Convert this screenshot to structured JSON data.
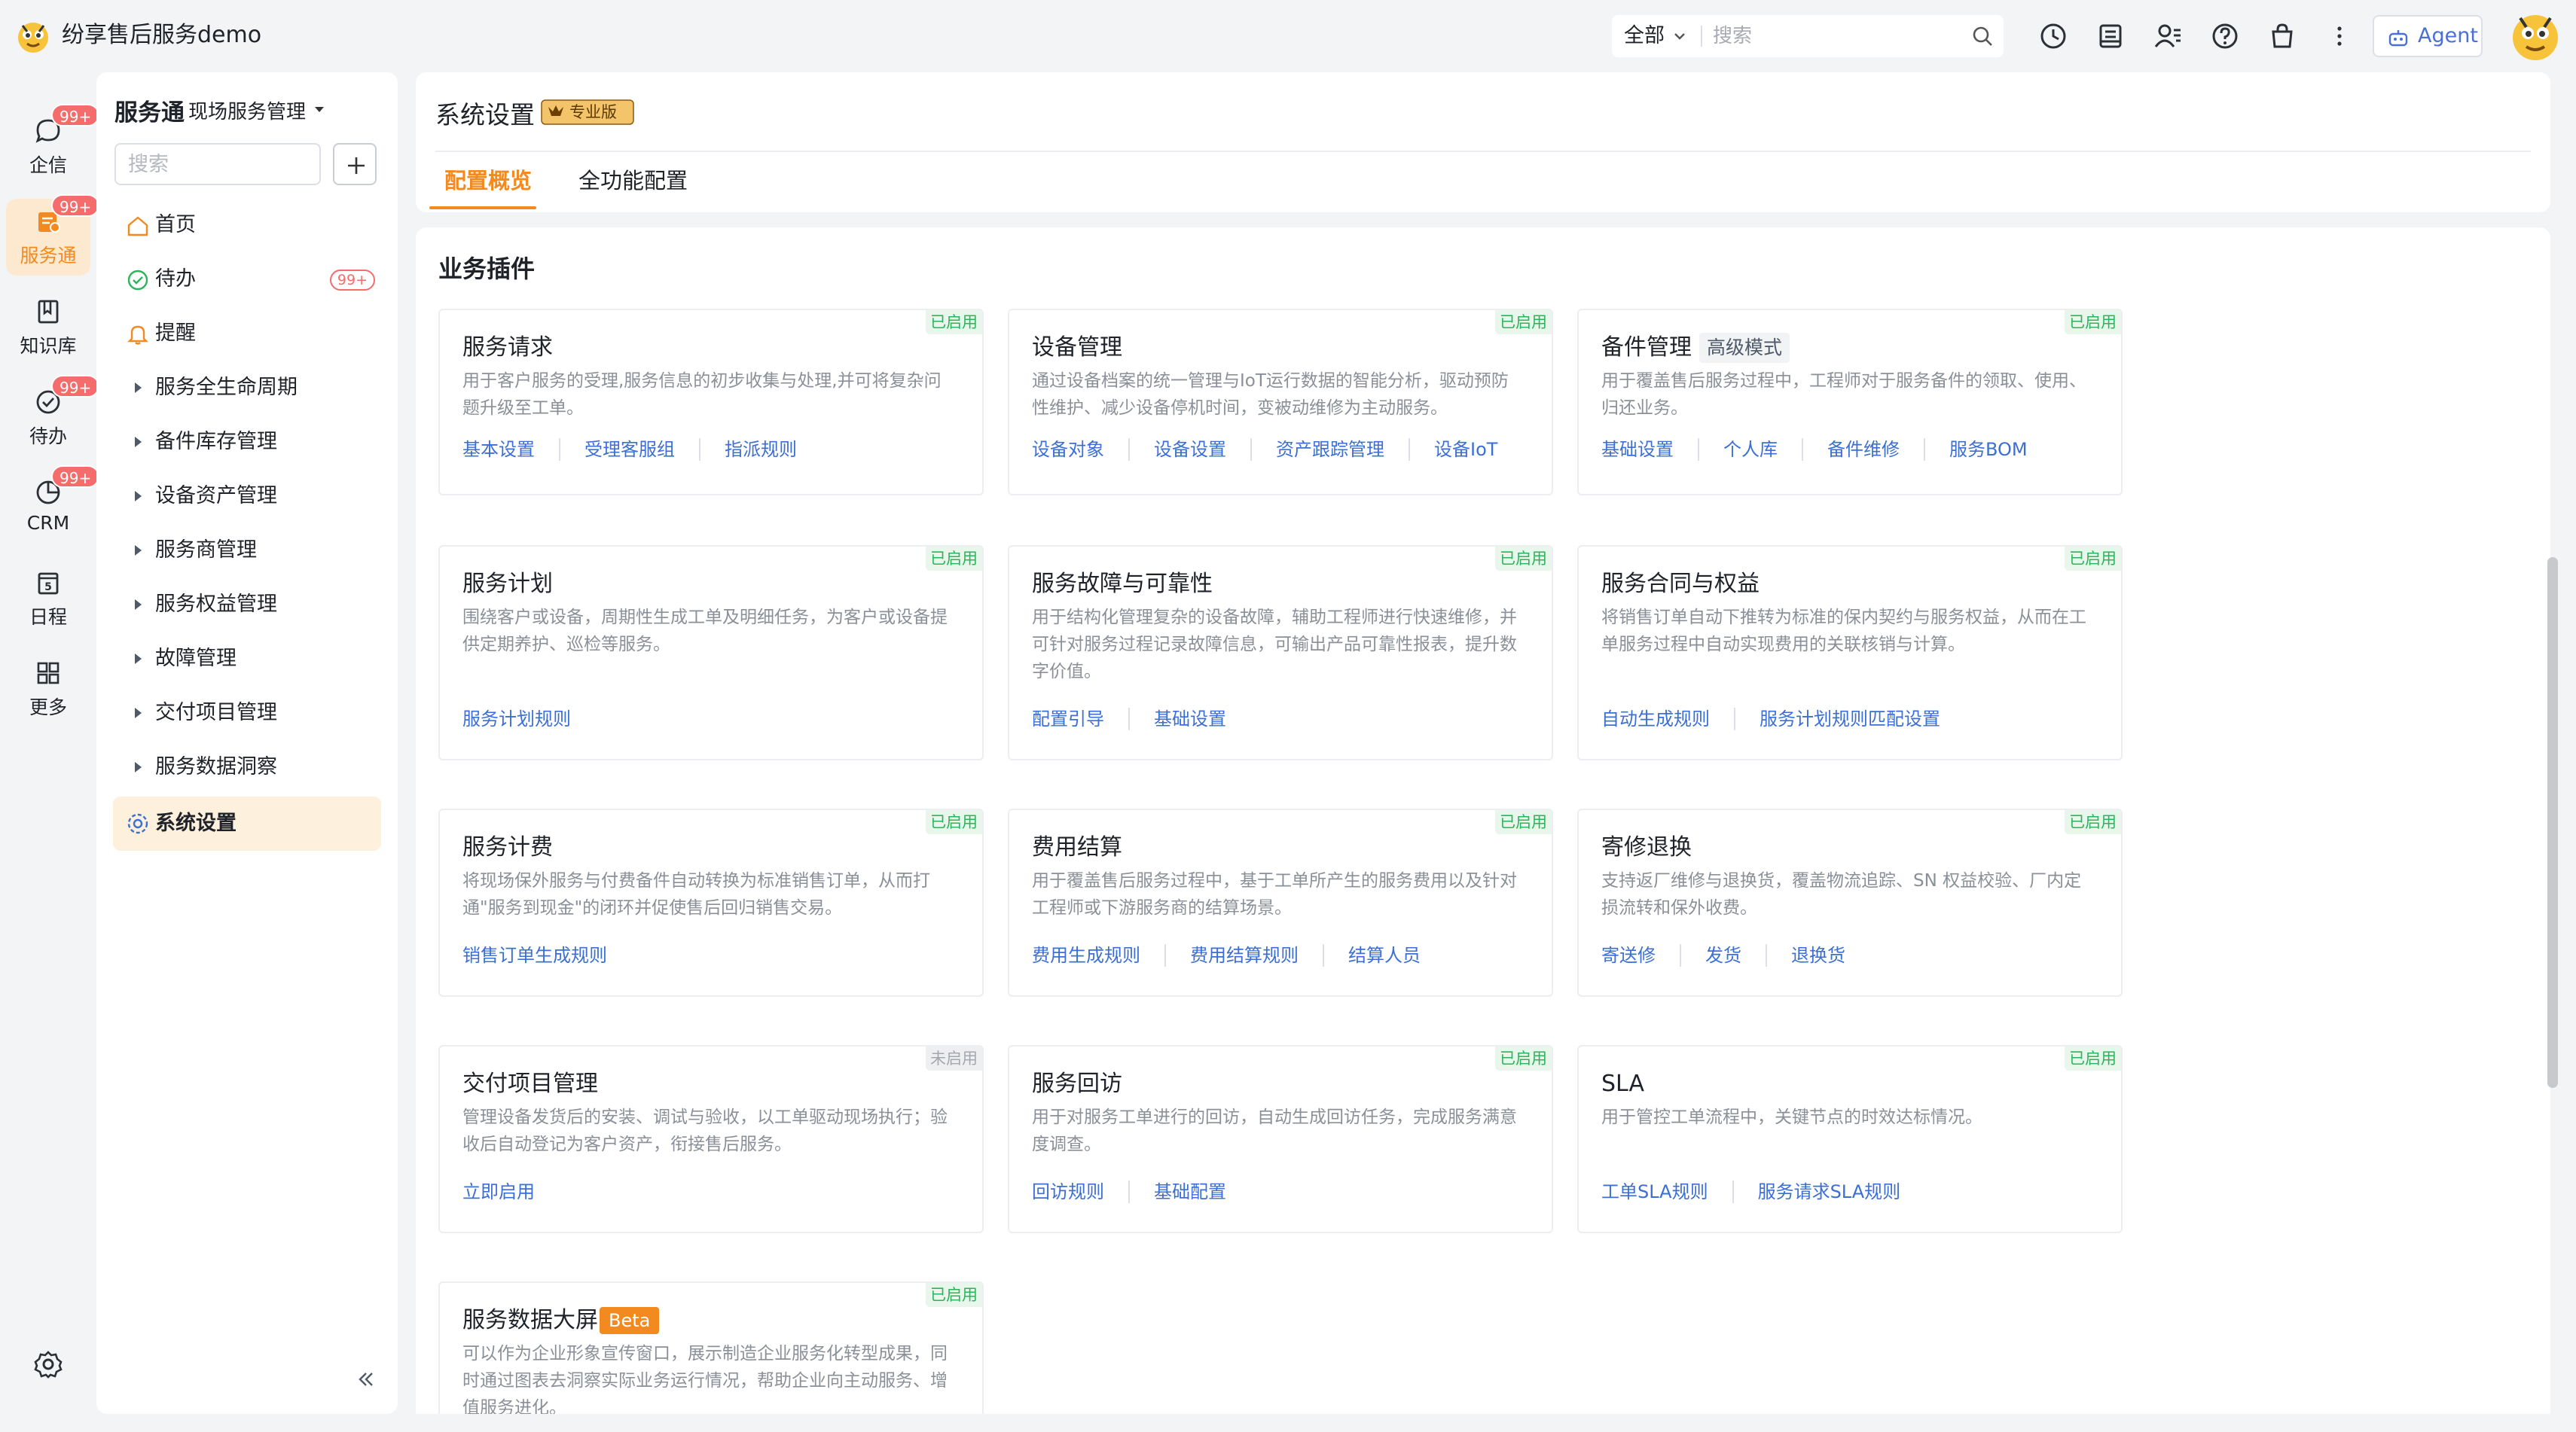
{
  "app": {
    "title": "纷享售后服务demo"
  },
  "topbar": {
    "search_scope": "全部",
    "search_placeholder": "搜索",
    "agent_label": "Agent",
    "icons": [
      "history-icon",
      "document-icon",
      "contacts-icon",
      "help-icon",
      "shop-icon",
      "more-icon"
    ]
  },
  "rail": {
    "items": [
      {
        "label": "企信",
        "badge": "99+",
        "icon": "chat-icon"
      },
      {
        "label": "服务通",
        "badge": "99+",
        "icon": "service-icon",
        "active": true
      },
      {
        "label": "知识库",
        "icon": "book-icon"
      },
      {
        "label": "待办",
        "badge": "99+",
        "icon": "check-icon"
      },
      {
        "label": "CRM",
        "badge": "99+",
        "icon": "pie-icon"
      },
      {
        "label": "日程",
        "icon": "calendar-icon"
      },
      {
        "label": "更多",
        "icon": "grid-icon"
      }
    ],
    "calendar_day": "5"
  },
  "sidebar": {
    "title": "服务通",
    "subtitle": "现场服务管理",
    "search_placeholder": "搜索",
    "items": [
      {
        "label": "首页",
        "icon": "home-icon"
      },
      {
        "label": "待办",
        "icon": "todo-icon",
        "badge": "99+"
      },
      {
        "label": "提醒",
        "icon": "bell-icon"
      },
      {
        "label": "服务全生命周期"
      },
      {
        "label": "备件库存管理"
      },
      {
        "label": "设备资产管理"
      },
      {
        "label": "服务商管理"
      },
      {
        "label": "服务权益管理"
      },
      {
        "label": "故障管理"
      },
      {
        "label": "交付项目管理"
      },
      {
        "label": "服务数据洞察"
      },
      {
        "label": "系统设置",
        "icon": "gear-icon",
        "active": true
      }
    ]
  },
  "header": {
    "title": "系统设置",
    "badge": "专业版",
    "tabs": [
      {
        "label": "配置概览",
        "active": true
      },
      {
        "label": "全功能配置"
      }
    ]
  },
  "main": {
    "section_title": "业务插件",
    "cards": [
      {
        "title": "服务请求",
        "status": "已启用",
        "desc": "用于客户服务的受理,服务信息的初步收集与处理,并可将复杂问题升级至工单。",
        "links": [
          "基本设置",
          "受理客服组",
          "指派规则"
        ]
      },
      {
        "title": "设备管理",
        "status": "已启用",
        "desc": "通过设备档案的统一管理与IoT运行数据的智能分析，驱动预防性维护、减少设备停机时间，变被动维修为主动服务。",
        "links": [
          "设备对象",
          "设备设置",
          "资产跟踪管理",
          "设备IoT"
        ]
      },
      {
        "title": "备件管理",
        "tag": "高级模式",
        "status": "已启用",
        "desc": "用于覆盖售后服务过程中，工程师对于服务备件的领取、使用、归还业务。",
        "links": [
          "基础设置",
          "个人库",
          "备件维修",
          "服务BOM"
        ]
      },
      {
        "title": "服务计划",
        "status": "已启用",
        "desc": "围绕客户或设备，周期性生成工单及明细任务，为客户或设备提供定期养护、巡检等服务。",
        "links": [
          "服务计划规则"
        ]
      },
      {
        "title": "服务故障与可靠性",
        "status": "已启用",
        "desc": "用于结构化管理复杂的设备故障，辅助工程师进行快速维修，并可针对服务过程记录故障信息，可输出产品可靠性报表，提升数字价值。",
        "links": [
          "配置引导",
          "基础设置"
        ]
      },
      {
        "title": "服务合同与权益",
        "status": "已启用",
        "desc": "将销售订单自动下推转为标准的保内契约与服务权益，从而在工单服务过程中自动实现费用的关联核销与计算。",
        "links": [
          "自动生成规则",
          "服务计划规则匹配设置"
        ]
      },
      {
        "title": "服务计费",
        "status": "已启用",
        "desc": "将现场保外服务与付费备件自动转换为标准销售订单，从而打通\"服务到现金\"的闭环并促使售后回归销售交易。",
        "links": [
          "销售订单生成规则"
        ]
      },
      {
        "title": "费用结算",
        "status": "已启用",
        "desc": "用于覆盖售后服务过程中，基于工单所产生的服务费用以及针对工程师或下游服务商的结算场景。",
        "links": [
          "费用生成规则",
          "费用结算规则",
          "结算人员"
        ]
      },
      {
        "title": "寄修退换",
        "status": "已启用",
        "desc": "支持返厂维修与退换货，覆盖物流追踪、SN 权益校验、厂内定损流转和保外收费。",
        "links": [
          "寄送修",
          "发货",
          "退换货"
        ]
      },
      {
        "title": "交付项目管理",
        "status": "未启用",
        "disabled": true,
        "desc": "管理设备发货后的安装、调试与验收，以工单驱动现场执行；验收后自动登记为客户资产，衔接售后服务。",
        "links": [
          "立即启用"
        ]
      },
      {
        "title": "服务回访",
        "status": "已启用",
        "desc": "用于对服务工单进行的回访，自动生成回访任务，完成服务满意度调查。",
        "links": [
          "回访规则",
          "基础配置"
        ]
      },
      {
        "title": "SLA",
        "status": "已启用",
        "desc": "用于管控工单流程中，关键节点的时效达标情况。",
        "links": [
          "工单SLA规则",
          "服务请求SLA规则"
        ]
      },
      {
        "title": "服务数据大屏",
        "tag": "Beta",
        "status": "已启用",
        "desc": "可以作为企业形象宣传窗口，展示制造企业服务化转型成果，同时通过图表去洞察实际业务运行情况，帮助企业向主动服务、增值服务进化。",
        "links": []
      }
    ]
  },
  "colors": {
    "accent": "#f28a1f",
    "link": "#3b6fd6",
    "enabled": "#2bb55a",
    "badge": "#f56c6c"
  }
}
